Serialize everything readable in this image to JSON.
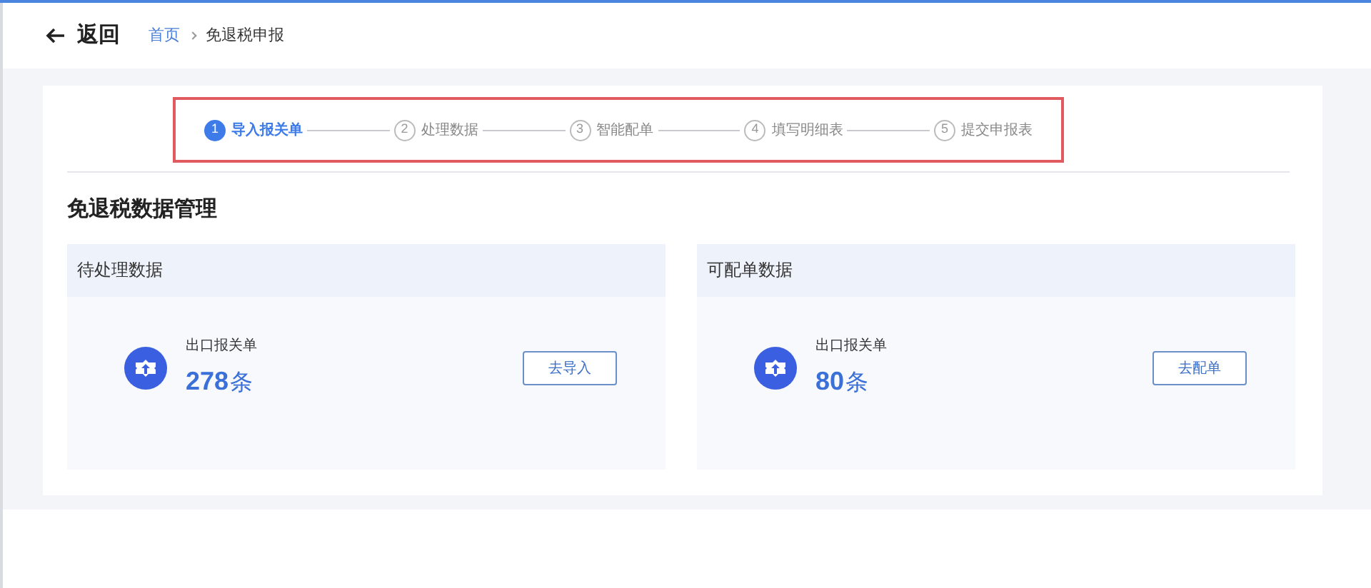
{
  "header": {
    "back_label": "返回",
    "breadcrumb": [
      "首页",
      "免退税申报"
    ]
  },
  "steps": [
    {
      "number": "1",
      "label": "导入报关单",
      "selected": true
    },
    {
      "number": "2",
      "label": "处理数据",
      "selected": false
    },
    {
      "number": "3",
      "label": "智能配单",
      "selected": false
    },
    {
      "number": "4",
      "label": "填写明细表",
      "selected": false
    },
    {
      "number": "5",
      "label": "提交申报表",
      "selected": false
    }
  ],
  "section_title": "免退税数据管理",
  "cards": [
    {
      "title": "待处理数据",
      "item_label": "出口报关单",
      "count": "278",
      "unit": "条",
      "button": "去导入"
    },
    {
      "title": "可配单数据",
      "item_label": "出口报关单",
      "count": "80",
      "unit": "条",
      "button": "去配单"
    }
  ]
}
